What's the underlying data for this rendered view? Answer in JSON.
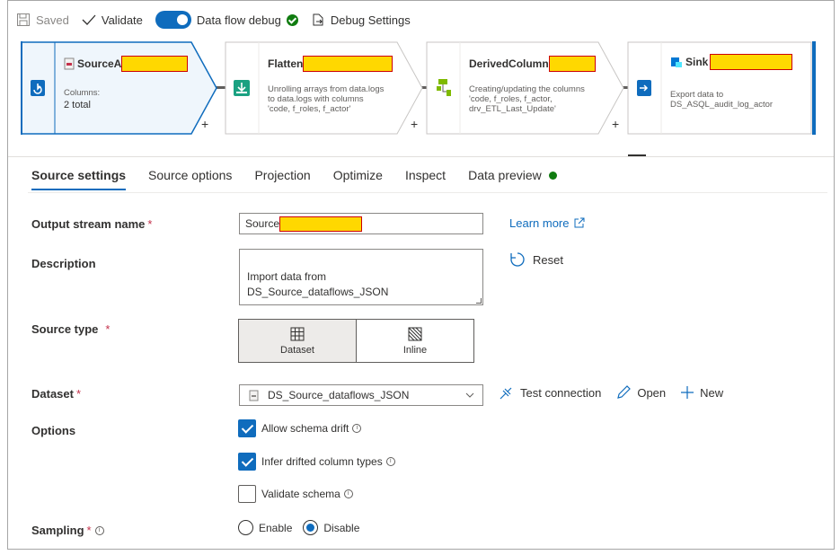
{
  "toolbar": {
    "saved_label": "Saved",
    "validate_label": "Validate",
    "debug_label": "Data flow debug",
    "debug_on": true,
    "debug_settings_label": "Debug Settings"
  },
  "pipeline": {
    "nodes": [
      {
        "title": "SourceA",
        "desc_label": "Columns:",
        "desc_value": "2 total"
      },
      {
        "title": "Flatten",
        "desc": "Unrolling arrays from data.logs\nto data.logs with columns\n'code, f_roles, f_actor'"
      },
      {
        "title": "DerivedColumn",
        "desc": "Creating/updating the columns\n'code, f_roles, f_actor,\ndrv_ETL_Last_Update'"
      },
      {
        "title": "Sink",
        "desc": "Export data to\nDS_ASQL_audit_log_actor"
      }
    ],
    "plus": "+"
  },
  "tabs": [
    {
      "label": "Source settings",
      "active": true
    },
    {
      "label": "Source options"
    },
    {
      "label": "Projection"
    },
    {
      "label": "Optimize"
    },
    {
      "label": "Inspect"
    },
    {
      "label": "Data preview"
    }
  ],
  "form": {
    "output_stream_label": "Output stream name",
    "output_stream_value": "Source",
    "learn_more": "Learn more",
    "description_label": "Description",
    "description_value": "Import data from\nDS_Source_dataflows_JSON",
    "reset_label": "Reset",
    "source_type_label": "Source type",
    "source_type_options": [
      "Dataset",
      "Inline"
    ],
    "source_type_selected": "Dataset",
    "dataset_label": "Dataset",
    "dataset_value": "DS_Source_dataflows_JSON",
    "test_connection": "Test connection",
    "open": "Open",
    "new": "New",
    "options_label": "Options",
    "allow_schema_drift": "Allow schema drift",
    "infer_drifted": "Infer drifted column types",
    "validate_schema": "Validate schema",
    "sampling_label": "Sampling",
    "sampling_enable": "Enable",
    "sampling_disable": "Disable",
    "required_mark": "*",
    "info_mark": "i"
  },
  "colors": {
    "accent": "#0f6cbd",
    "success": "#107c10",
    "highlight": "#ffd800"
  }
}
